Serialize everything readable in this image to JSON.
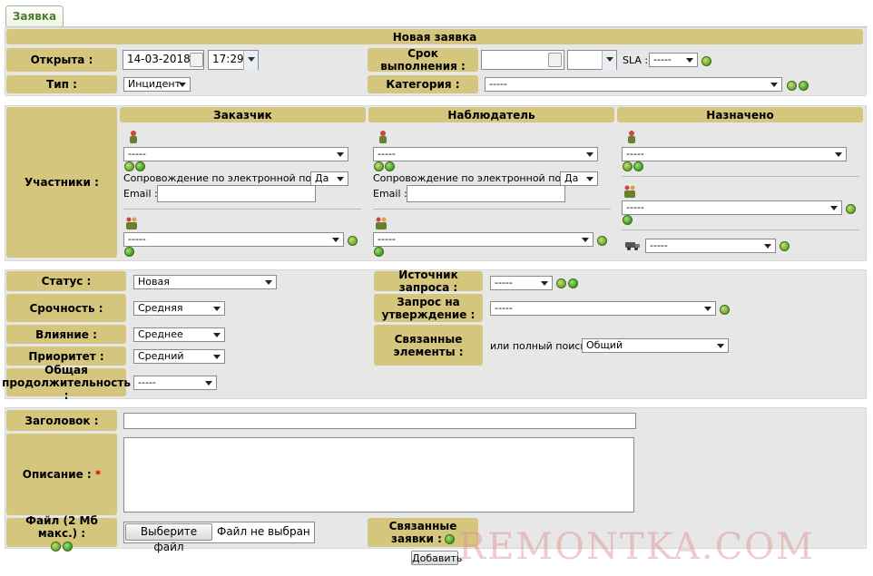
{
  "tab": {
    "label": "Заявка"
  },
  "header": {
    "title": "Новая заявка"
  },
  "top": {
    "opened_label": "Открыта :",
    "opened_date": "14-03-2018",
    "opened_time": "17:29",
    "due_label": "Срок выполнения :",
    "due_date": "",
    "due_time": "",
    "sla_label": "SLA :",
    "sla_value": "-----",
    "type_label": "Тип :",
    "type_value": "Инцидент",
    "category_label": "Категория :",
    "category_value": "-----"
  },
  "actors": {
    "label": "Участники :",
    "requester": {
      "title": "Заказчик",
      "user_value": "-----",
      "email_follow_label": "Сопровождение по электронной почте :",
      "email_follow_value": "Да",
      "email_label": "Email :",
      "email_value": "",
      "group_value": "-----"
    },
    "observer": {
      "title": "Наблюдатель",
      "user_value": "-----",
      "email_follow_label": "Сопровождение по электронной почте :",
      "email_follow_value": "Да",
      "email_label": "Email :",
      "email_value": "",
      "group_value": "-----"
    },
    "assigned": {
      "title": "Назначено",
      "user_value": "-----",
      "group_value": "-----",
      "supplier_value": "-----"
    }
  },
  "details": {
    "status_label": "Статус :",
    "status_value": "Новая",
    "urgency_label": "Срочность :",
    "urgency_value": "Средняя",
    "impact_label": "Влияние :",
    "impact_value": "Среднее",
    "priority_label": "Приоритет :",
    "priority_value": "Средний",
    "duration_label_line1": "Общая",
    "duration_label_line2": "продолжительность :",
    "duration_value": "-----",
    "source_label": "Источник запроса :",
    "source_value": "-----",
    "validation_label_line1": "Запрос на",
    "validation_label_line2": "утверждение :",
    "validation_value": "-----",
    "linked_items_label_line1": "Связанные",
    "linked_items_label_line2": "элементы :",
    "full_search_label": "или полный поиск :",
    "full_search_value": "Общий"
  },
  "content": {
    "title_label": "Заголовок :",
    "title_value": "",
    "description_label": "Описание :",
    "required_mark": "*",
    "description_value": "",
    "file_label": "Файл (2 Мб макс.) :",
    "file_button": "Выберите файл",
    "file_status": "Файл не выбран",
    "linked_tickets_line1": "Связанные",
    "linked_tickets_line2": "заявки :",
    "submit_label": "Добавить"
  },
  "watermark": "REMONTKA.COM",
  "colors": {
    "label_bg": "#d5c67e",
    "panel_bg": "#e7e7e7",
    "tab_text": "#4a7d2b",
    "icon_green": "#4e8a19"
  }
}
